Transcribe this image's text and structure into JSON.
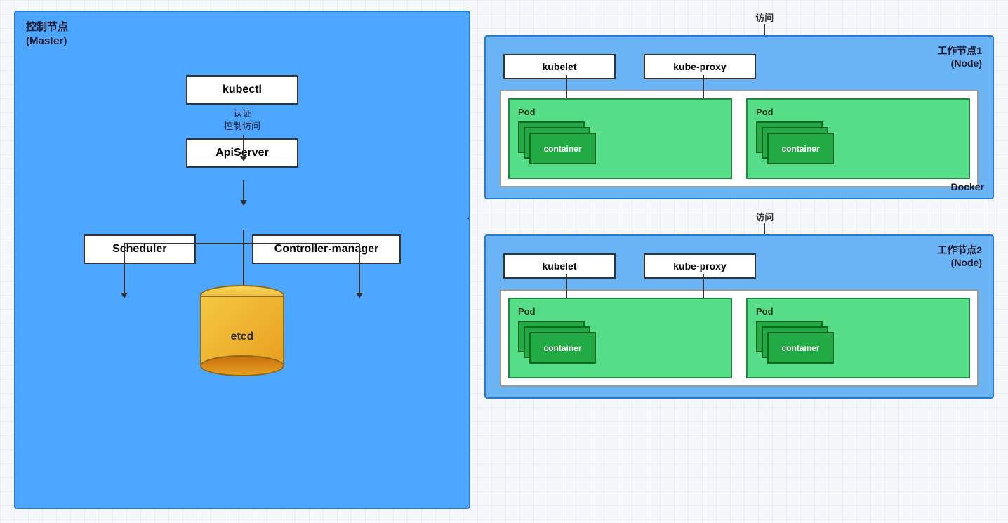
{
  "master": {
    "label_line1": "控制节点",
    "label_line2": "(Master)",
    "kubectl": "kubectl",
    "auth_label_line1": "认证",
    "auth_label_line2": "控制访问",
    "apiserver": "ApiServer",
    "scheduler": "Scheduler",
    "controller_manager": "Controller-manager",
    "etcd": "etcd"
  },
  "worker1": {
    "label_line1": "工作节点1",
    "label_line2": "(Node)",
    "access": "访问",
    "kubelet": "kubelet",
    "kube_proxy": "kube-proxy",
    "pod1_label": "Pod",
    "pod2_label": "Pod",
    "container_label": "container",
    "docker_label": "Docker"
  },
  "worker2": {
    "label_line1": "工作节点2",
    "label_line2": "(Node)",
    "access": "访问",
    "kubelet": "kubelet",
    "kube_proxy": "kube-proxy",
    "pod1_label": "Pod",
    "pod2_label": "Pod",
    "container_label": "container"
  },
  "pods": {
    "pod_container_label": "Pod container"
  }
}
